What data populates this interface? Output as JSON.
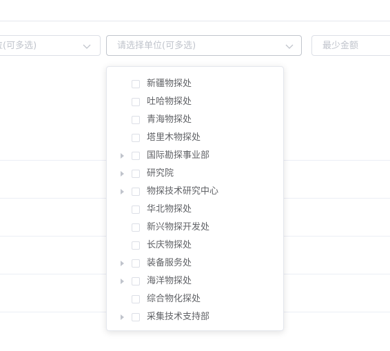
{
  "filters": {
    "left_select_placeholder": "位(可多选)",
    "unit_select_placeholder": "请选择单位(可多选)",
    "min_amount_placeholder": "最少金额"
  },
  "dropdown": {
    "items": [
      {
        "label": "新疆物探处",
        "expandable": false
      },
      {
        "label": "吐哈物探处",
        "expandable": false
      },
      {
        "label": "青海物探处",
        "expandable": false
      },
      {
        "label": "塔里木物探处",
        "expandable": false
      },
      {
        "label": "国际勘探事业部",
        "expandable": true
      },
      {
        "label": "研究院",
        "expandable": true
      },
      {
        "label": "物探技术研究中心",
        "expandable": true
      },
      {
        "label": "华北物探处",
        "expandable": false
      },
      {
        "label": "新兴物探开发处",
        "expandable": false
      },
      {
        "label": "长庆物探处",
        "expandable": false
      },
      {
        "label": "装备服务处",
        "expandable": true
      },
      {
        "label": "海洋物探处",
        "expandable": true
      },
      {
        "label": "综合物化探处",
        "expandable": false
      },
      {
        "label": "采集技术支持部",
        "expandable": true
      }
    ],
    "scroll_position": 0.0
  },
  "colors": {
    "border": "#dcdfe6",
    "placeholder": "#c0c4cc",
    "text": "#606266",
    "scroll_thumb": "#c1c1c1"
  }
}
